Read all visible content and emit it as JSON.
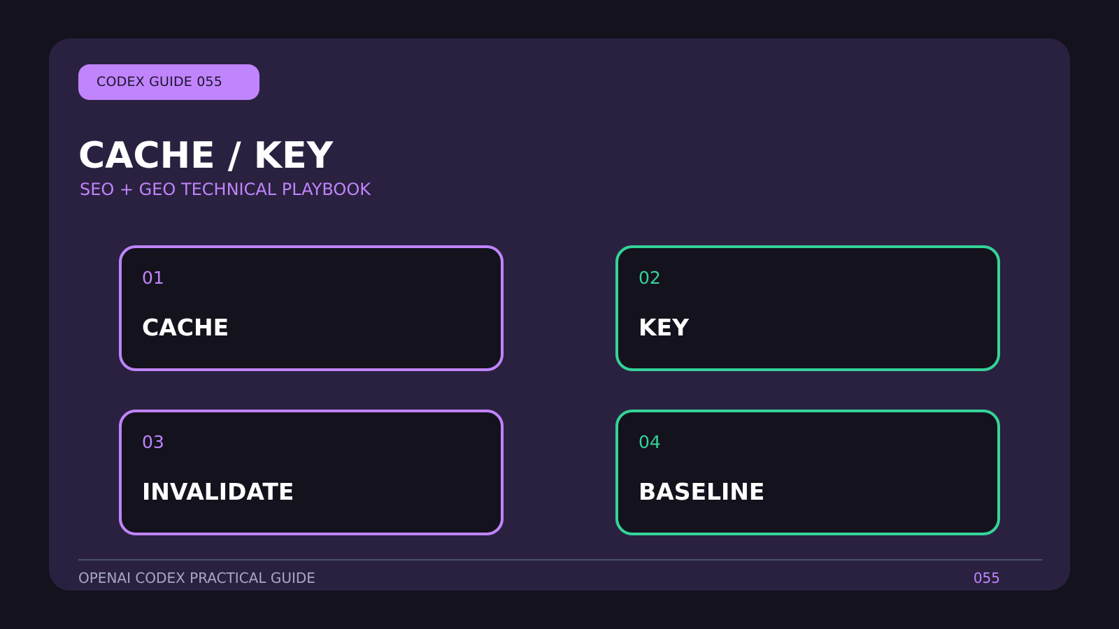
{
  "badge": "CODEX GUIDE 055",
  "title": "CACHE / KEY",
  "subtitle": "SEO + GEO TECHNICAL PLAYBOOK",
  "cards": [
    {
      "num": "01",
      "label": "CACHE",
      "accent": "#c084fc"
    },
    {
      "num": "02",
      "label": "KEY",
      "accent": "#34d399"
    },
    {
      "num": "03",
      "label": "INVALIDATE",
      "accent": "#c084fc"
    },
    {
      "num": "04",
      "label": "BASELINE",
      "accent": "#34d399"
    }
  ],
  "footer": {
    "left": "OPENAI CODEX PRACTICAL GUIDE",
    "right": "055"
  },
  "colors": {
    "background": "#13121d",
    "panel": "#2a2140",
    "purple": "#c084fc",
    "green": "#34d399",
    "text": "#ffffff"
  }
}
